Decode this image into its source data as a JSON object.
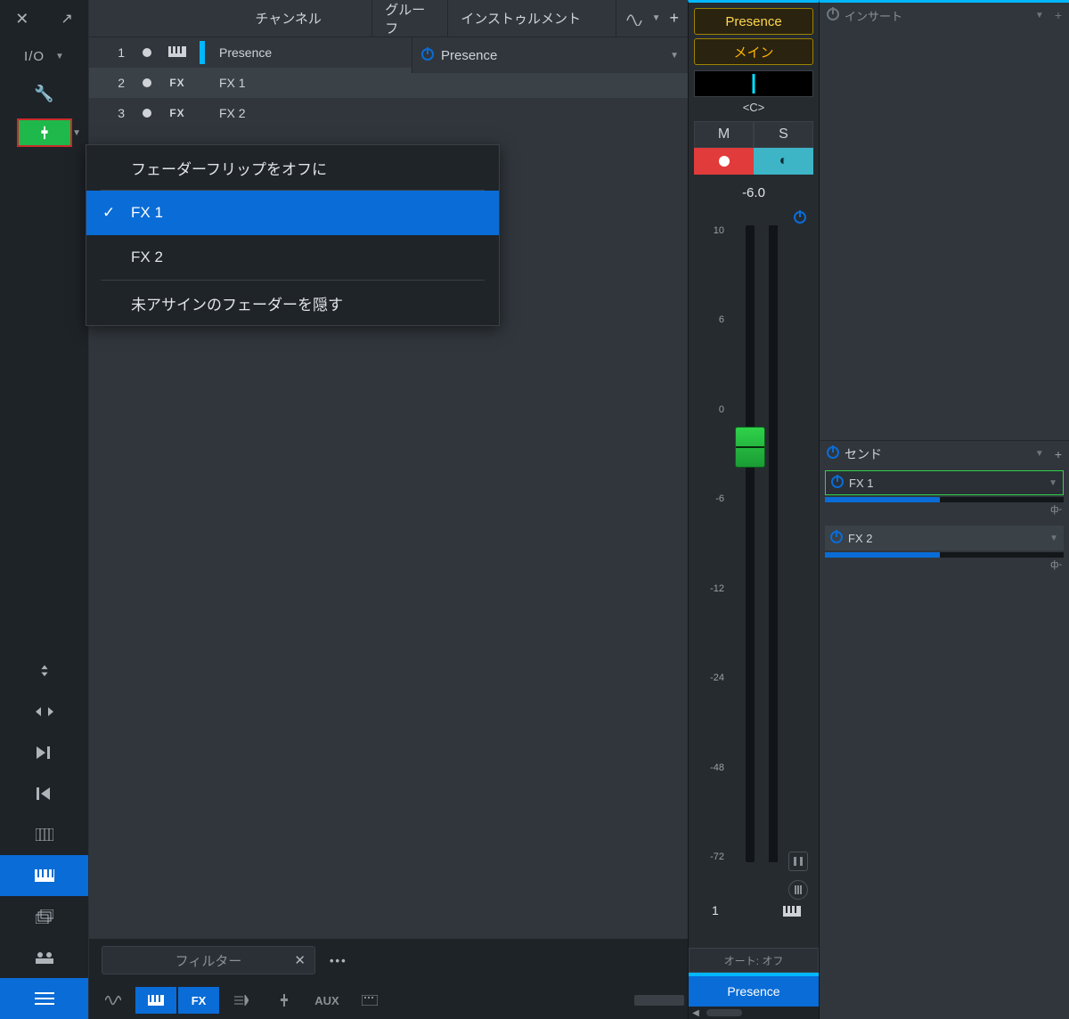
{
  "sidebar": {
    "io_label": "I/O"
  },
  "tabs": {
    "channel": "チャンネル",
    "group": "グルーフ",
    "instrument": "インストゥルメント"
  },
  "tracks": [
    {
      "index": "1",
      "type": "instr",
      "name": "Presence"
    },
    {
      "index": "2",
      "type": "fx",
      "type_label": "FX",
      "name": "FX 1"
    },
    {
      "index": "3",
      "type": "fx",
      "type_label": "FX",
      "name": "FX 2"
    }
  ],
  "instrument_strip": {
    "name": "Presence"
  },
  "context_menu": {
    "flip_off": "フェーダーフリップをオフに",
    "fx1": "FX 1",
    "fx2": "FX 2",
    "hide_unassigned": "未アサインのフェーダーを隠す"
  },
  "filter": {
    "placeholder": "フィルター",
    "more": "•••"
  },
  "switches": {
    "instr": "",
    "fx": "FX",
    "aux": "AUX"
  },
  "channel": {
    "name_top": "Presence",
    "main": "メイン",
    "pan_label": "<C>",
    "mute": "M",
    "solo": "S",
    "db": "-6.0",
    "scale": [
      "10",
      "6",
      "0",
      "-6",
      "-12",
      "-24",
      "-48",
      "-72"
    ],
    "index": "1",
    "automation": "オート: オフ",
    "footer": "Presence"
  },
  "inspector": {
    "inserts_label": "インサート",
    "sends_label": "センド",
    "sends": [
      {
        "name": "FX 1",
        "marker": "ф-"
      },
      {
        "name": "FX 2",
        "marker": "ф-"
      }
    ]
  }
}
